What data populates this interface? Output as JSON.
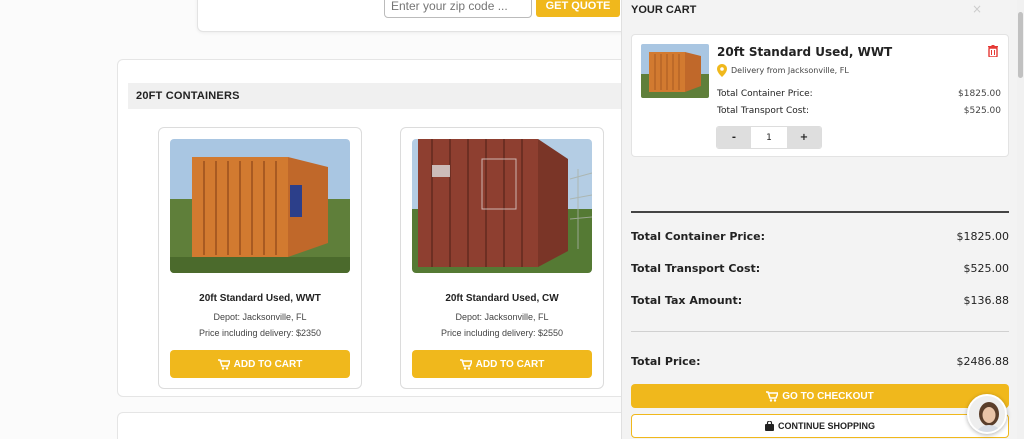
{
  "zip": {
    "placeholder": "Enter your zip code ...",
    "quote_label": "GET QUOTE"
  },
  "section": {
    "title": "20FT CONTAINERS"
  },
  "products": [
    {
      "name": "20ft Standard Used, WWT",
      "depot": "Depot: Jacksonville, FL",
      "price": "Price including delivery: $2350",
      "button": "ADD TO CART",
      "color": "#d87a2c"
    },
    {
      "name": "20ft Standard Used, CW",
      "depot": "Depot: Jacksonville, FL",
      "price": "Price including delivery: $2550",
      "button": "ADD TO CART",
      "color": "#9c4a36"
    }
  ],
  "cart": {
    "title": "YOUR CART",
    "close": "×",
    "item": {
      "name": "20ft Standard Used, WWT",
      "location": "Delivery from Jacksonville, FL",
      "container_label": "Total Container Price:",
      "container_value": "$1825.00",
      "transport_label": "Total Transport Cost:",
      "transport_value": "$525.00",
      "minus": "-",
      "qty": "1",
      "plus": "+"
    },
    "summary": {
      "container_label": "Total Container Price:",
      "container_value": "$1825.00",
      "transport_label": "Total Transport Cost:",
      "transport_value": "$525.00",
      "tax_label": "Total Tax Amount:",
      "tax_value": "$136.88",
      "total_label": "Total Price:",
      "total_value": "$2486.88"
    },
    "checkout_label": "GO TO CHECKOUT",
    "continue_label": "CONTINUE SHOPPING"
  },
  "colors": {
    "accent": "#f0b81c",
    "trash": "#e53935",
    "pin": "#f0b81c"
  }
}
